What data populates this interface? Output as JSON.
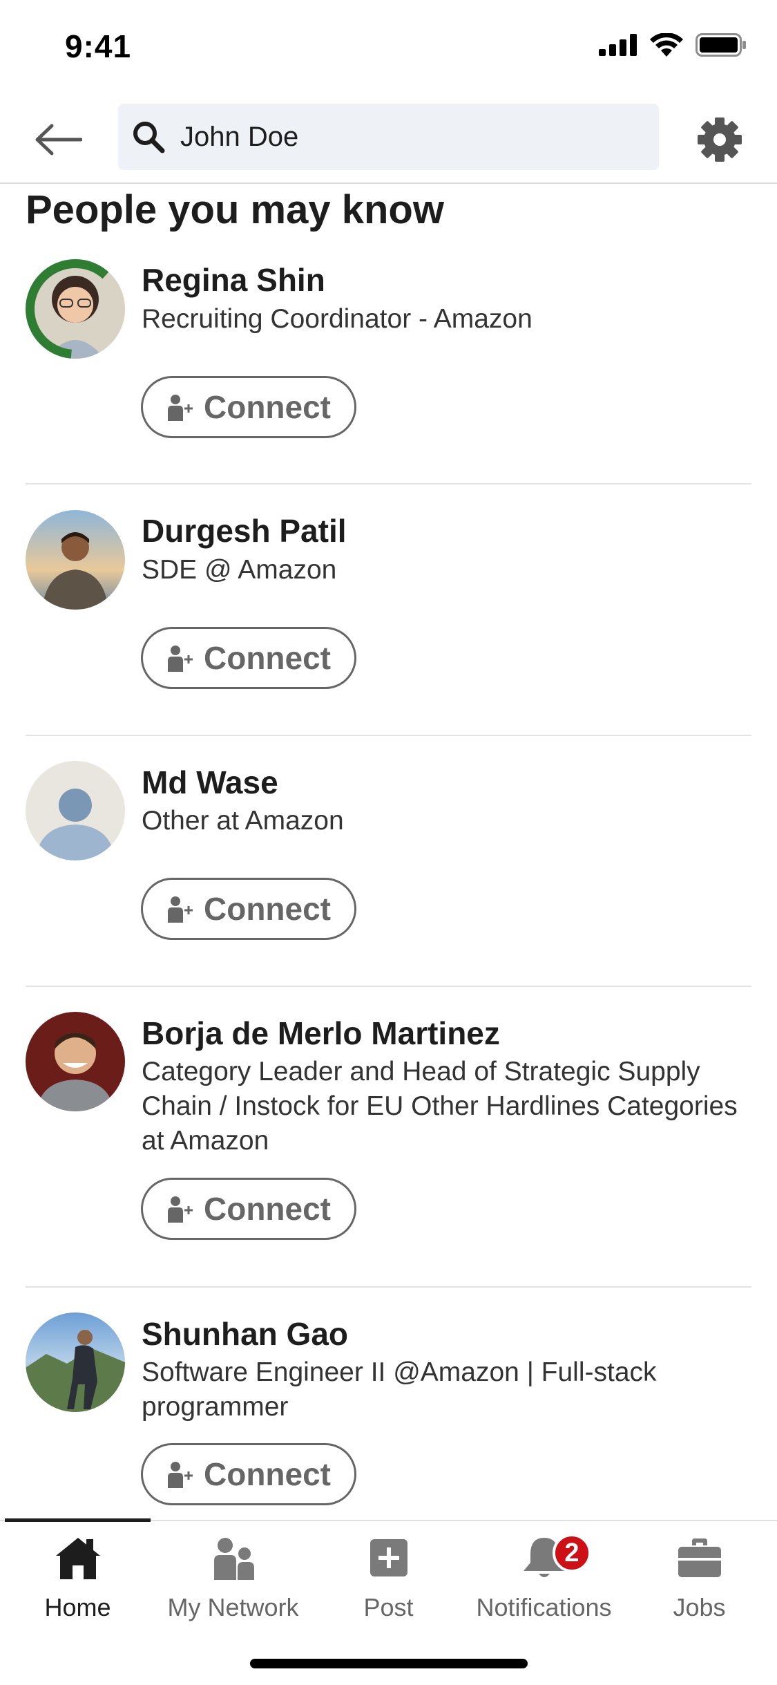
{
  "status_bar": {
    "time": "9:41"
  },
  "search": {
    "value": "John Doe"
  },
  "section": {
    "title": "People you may know"
  },
  "people": [
    {
      "name": "Regina Shin",
      "headline": "Recruiting Coordinator - Amazon",
      "connect_label": "Connect",
      "avatar_badge": "#OPENTOWORK"
    },
    {
      "name": "Durgesh Patil",
      "headline": "SDE @ Amazon",
      "connect_label": "Connect"
    },
    {
      "name": "Md Wase",
      "headline": "Other at Amazon",
      "connect_label": "Connect"
    },
    {
      "name": "Borja de Merlo Martinez",
      "headline": "Category Leader and Head of Strategic Supply Chain / Instock for EU Other Hardlines Categories at Amazon",
      "connect_label": "Connect"
    },
    {
      "name": "Shunhan Gao",
      "headline": "Software Engineer II @Amazon | Full-stack programmer",
      "connect_label": "Connect"
    }
  ],
  "tabs": [
    {
      "label": "Home",
      "icon": "home-icon",
      "active": true
    },
    {
      "label": "My Network",
      "icon": "network-icon"
    },
    {
      "label": "Post",
      "icon": "post-icon"
    },
    {
      "label": "Notifications",
      "icon": "bell-icon",
      "badge": "2"
    },
    {
      "label": "Jobs",
      "icon": "briefcase-icon"
    }
  ],
  "colors": {
    "accent_badge": "#cc1016",
    "open_to_work": "#2e7d32",
    "icon_gray": "#666666"
  }
}
